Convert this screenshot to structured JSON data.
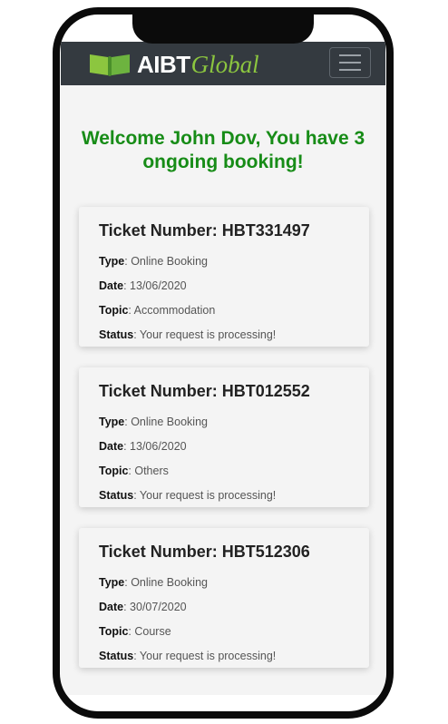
{
  "app": {
    "brand_primary": "AIBT",
    "brand_secondary": "Global",
    "colors": {
      "navbar": "#343a40",
      "welcome": "#178c17",
      "brand_green": "#8cc63f"
    }
  },
  "navbar": {
    "menu_icon": "hamburger-menu-icon"
  },
  "welcome": {
    "text": "Welcome John Dov, You have 3 ongoing booking!"
  },
  "labels": {
    "type": "Type",
    "date": "Date",
    "topic": "Topic",
    "status": "Status"
  },
  "tickets": [
    {
      "title": "Ticket Number: HBT331497",
      "type": ": Online Booking",
      "date": ": 13/06/2020",
      "topic": ": Accommodation",
      "status": ": Your request is processing!"
    },
    {
      "title": "Ticket Number: HBT012552",
      "type": ": Online Booking",
      "date": ": 13/06/2020",
      "topic": ": Others",
      "status": ": Your request is processing!"
    },
    {
      "title": "Ticket Number: HBT512306",
      "type": ": Online Booking",
      "date": ": 30/07/2020",
      "topic": ": Course",
      "status": ": Your request is processing!"
    }
  ]
}
